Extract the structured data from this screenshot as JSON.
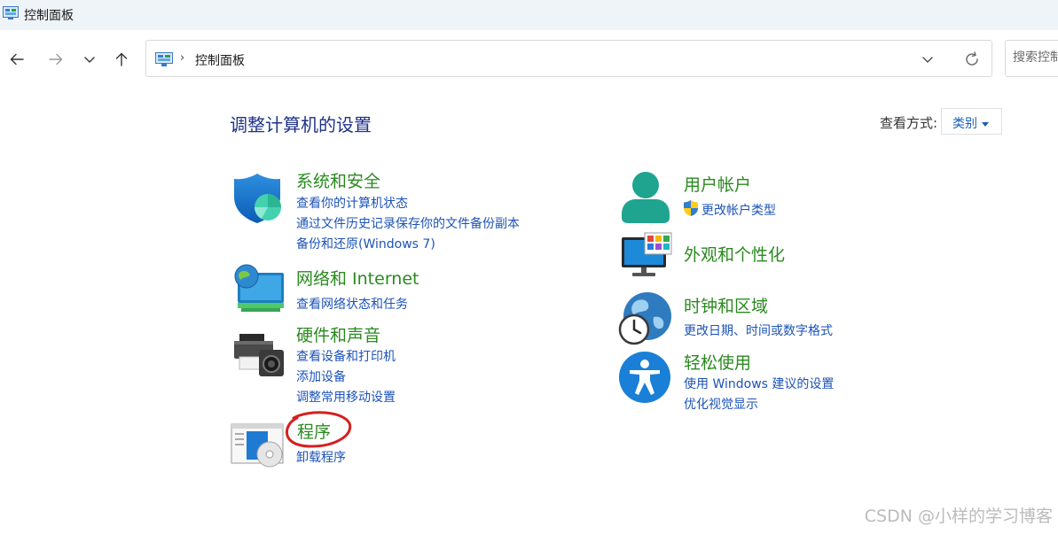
{
  "window": {
    "title": "控制面板"
  },
  "address": {
    "crumb": "控制面板"
  },
  "search": {
    "placeholder": "搜索控制面板"
  },
  "main": {
    "heading": "调整计算机的设置",
    "view_by_label": "查看方式:",
    "view_by_value": "类别"
  },
  "categories": {
    "system": {
      "title": "系统和安全",
      "links": [
        "查看你的计算机状态",
        "通过文件历史记录保存你的文件备份副本",
        "备份和还原(Windows 7)"
      ]
    },
    "network": {
      "title": "网络和 Internet",
      "links": [
        "查看网络状态和任务"
      ]
    },
    "hardware": {
      "title": "硬件和声音",
      "links": [
        "查看设备和打印机",
        "添加设备",
        "调整常用移动设置"
      ]
    },
    "programs": {
      "title": "程序",
      "links": [
        "卸载程序"
      ]
    },
    "accounts": {
      "title": "用户帐户",
      "links": [
        "更改帐户类型"
      ]
    },
    "appearance": {
      "title": "外观和个性化"
    },
    "clock": {
      "title": "时钟和区域",
      "links": [
        "更改日期、时间或数字格式"
      ]
    },
    "ease": {
      "title": "轻松使用",
      "links": [
        "使用 Windows 建议的设置",
        "优化视觉显示"
      ]
    }
  },
  "annotation": {
    "color": "#d42020"
  },
  "watermark": "CSDN @小样的学习博客",
  "colors": {
    "title_green": "#2a8a1f",
    "link_blue": "#1c53b8",
    "heading_blue": "#1e3287"
  }
}
